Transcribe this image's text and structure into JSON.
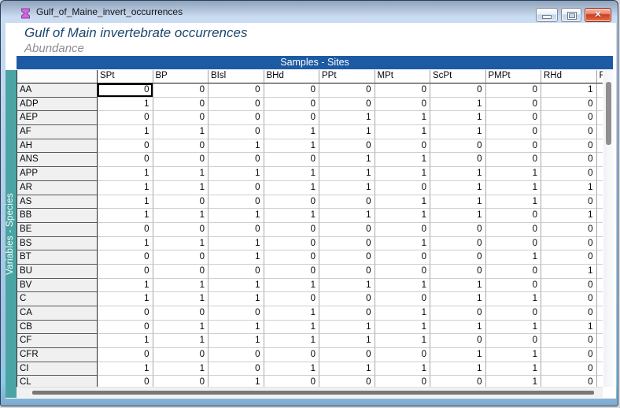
{
  "window": {
    "title": "Gulf_of_Maine_invert_occurrences",
    "icon": "worksheet-hourglass-icon",
    "controls": [
      {
        "name": "minimize",
        "icon": "minimize-icon"
      },
      {
        "name": "maximize",
        "icon": "maximize-icon"
      },
      {
        "name": "close",
        "icon": "close-icon",
        "glyph": "✕"
      }
    ]
  },
  "sheet": {
    "title": "Gulf of Main invertebrate occurrences",
    "subtitle": "Abundance"
  },
  "bands": {
    "columns": "Samples - Sites",
    "rows": "Variables - Species"
  },
  "table": {
    "corner_label": "",
    "columns": [
      "SPt",
      "BP",
      "BIsl",
      "BHd",
      "PPt",
      "MPt",
      "ScPt",
      "PMPt",
      "RHd",
      "R"
    ],
    "selected_cell": {
      "row": "AA",
      "column": "SPt"
    },
    "rows": [
      {
        "label": "AA",
        "values": [
          0,
          0,
          0,
          0,
          0,
          0,
          0,
          0,
          1,
          ""
        ]
      },
      {
        "label": "ADP",
        "values": [
          1,
          0,
          0,
          0,
          0,
          0,
          1,
          0,
          0,
          ""
        ]
      },
      {
        "label": "AEP",
        "values": [
          0,
          0,
          0,
          0,
          1,
          1,
          1,
          0,
          0,
          ""
        ]
      },
      {
        "label": "AF",
        "values": [
          1,
          1,
          0,
          1,
          1,
          1,
          1,
          0,
          0,
          ""
        ]
      },
      {
        "label": "AH",
        "values": [
          0,
          0,
          1,
          1,
          0,
          0,
          0,
          0,
          0,
          ""
        ]
      },
      {
        "label": "ANS",
        "values": [
          0,
          0,
          0,
          0,
          1,
          1,
          0,
          0,
          0,
          ""
        ]
      },
      {
        "label": "APP",
        "values": [
          1,
          1,
          1,
          1,
          1,
          1,
          1,
          1,
          0,
          ""
        ]
      },
      {
        "label": "AR",
        "values": [
          1,
          1,
          0,
          1,
          1,
          0,
          1,
          1,
          1,
          ""
        ]
      },
      {
        "label": "AS",
        "values": [
          1,
          0,
          0,
          0,
          0,
          1,
          1,
          1,
          0,
          ""
        ]
      },
      {
        "label": "BB",
        "values": [
          1,
          1,
          1,
          1,
          1,
          1,
          1,
          0,
          1,
          ""
        ]
      },
      {
        "label": "BE",
        "values": [
          0,
          0,
          0,
          0,
          0,
          0,
          0,
          0,
          0,
          ""
        ]
      },
      {
        "label": "BS",
        "values": [
          1,
          1,
          1,
          0,
          0,
          1,
          0,
          0,
          0,
          ""
        ]
      },
      {
        "label": "BT",
        "values": [
          0,
          0,
          1,
          0,
          0,
          0,
          0,
          1,
          0,
          ""
        ]
      },
      {
        "label": "BU",
        "values": [
          0,
          0,
          0,
          0,
          0,
          0,
          0,
          0,
          1,
          ""
        ]
      },
      {
        "label": "BV",
        "values": [
          1,
          1,
          1,
          1,
          1,
          1,
          1,
          0,
          0,
          ""
        ]
      },
      {
        "label": "C",
        "values": [
          1,
          1,
          1,
          0,
          0,
          0,
          1,
          1,
          0,
          ""
        ]
      },
      {
        "label": "CA",
        "values": [
          0,
          0,
          0,
          1,
          0,
          1,
          0,
          0,
          0,
          ""
        ]
      },
      {
        "label": "CB",
        "values": [
          0,
          1,
          1,
          1,
          1,
          1,
          1,
          1,
          1,
          ""
        ]
      },
      {
        "label": "CF",
        "values": [
          1,
          1,
          1,
          1,
          1,
          1,
          0,
          0,
          0,
          ""
        ]
      },
      {
        "label": "CFR",
        "values": [
          0,
          0,
          0,
          0,
          0,
          0,
          1,
          1,
          0,
          ""
        ]
      },
      {
        "label": "CI",
        "values": [
          1,
          1,
          0,
          1,
          1,
          1,
          1,
          1,
          0,
          ""
        ]
      },
      {
        "label": "CL",
        "values": [
          0,
          0,
          1,
          0,
          0,
          0,
          0,
          1,
          0,
          ""
        ]
      }
    ]
  },
  "colors": {
    "band_blue": "#1d5aa4",
    "strip_teal": "#4ba4a4",
    "close_red": "#cf3d20",
    "row_header_bg": "#f0f0f0",
    "sheet_title_blue": "#1c4670",
    "subtitle_gray": "#8c8c8c",
    "selection_border": "#000000"
  }
}
